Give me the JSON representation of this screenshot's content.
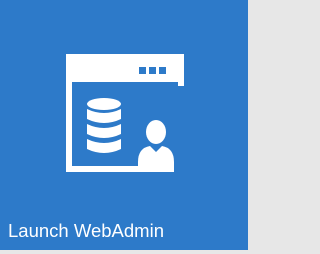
{
  "tile": {
    "label": "Launch WebAdmin",
    "icon": "webadmin-icon",
    "background_color": "#2d7ac9",
    "foreground_color": "#ffffff"
  }
}
